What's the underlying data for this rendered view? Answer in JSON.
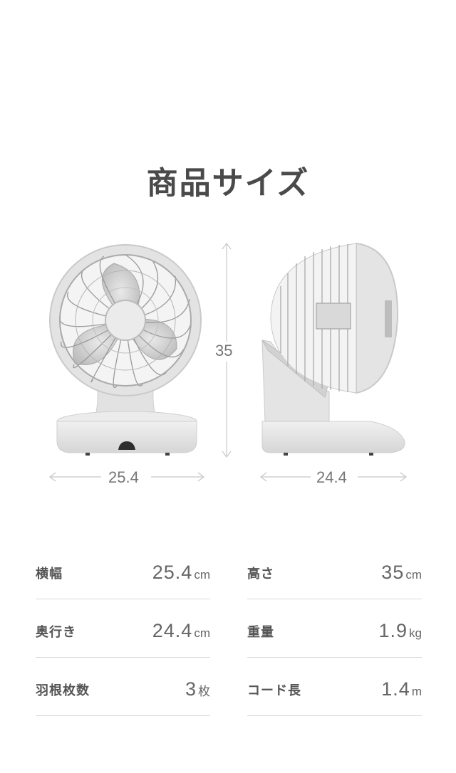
{
  "title": "商品サイズ",
  "dimensions": {
    "height": "35",
    "front_width": "25.4",
    "side_depth": "24.4"
  },
  "specs": [
    {
      "label": "横幅",
      "value": "25.4",
      "unit": "cm"
    },
    {
      "label": "高さ",
      "value": "35",
      "unit": "cm"
    },
    {
      "label": "奥行き",
      "value": "24.4",
      "unit": "cm"
    },
    {
      "label": "重量",
      "value": "1.9",
      "unit": "kg"
    },
    {
      "label": "羽根枚数",
      "value": "3",
      "unit": "枚"
    },
    {
      "label": "コード長",
      "value": "1.4",
      "unit": "m"
    }
  ],
  "colors": {
    "body": "#e6e6e6",
    "shade": "#c9c9c9",
    "dark": "#3a3a3a",
    "line": "#bdbdbd"
  }
}
